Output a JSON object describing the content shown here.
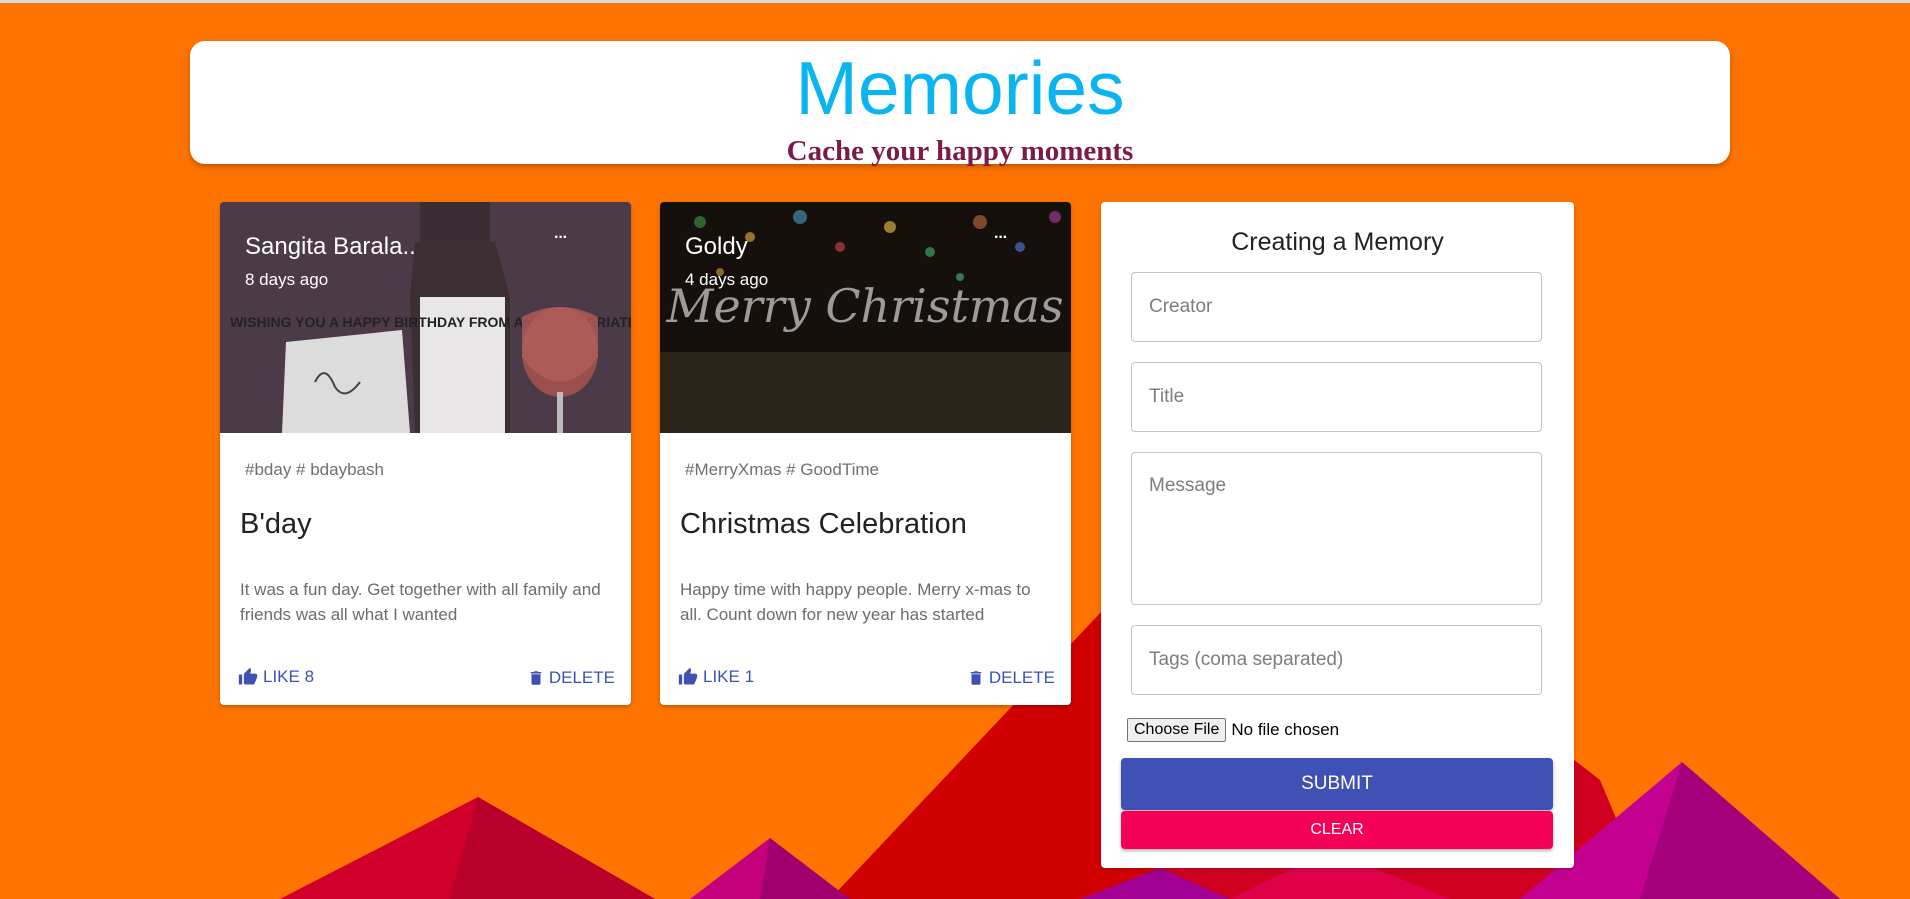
{
  "header": {
    "title": "Memories",
    "subtitle": "Cache your happy moments"
  },
  "posts": [
    {
      "creator": "Sangita Barala..",
      "time": "8 days ago",
      "more": "···",
      "tags": "#bday # bdaybash",
      "title": "B'day",
      "message": "It was a fun day. Get together with all family and friends was all what I wanted",
      "like_label": "LIKE 8",
      "delete_label": "DELETE",
      "image_text": "WISHING YOU A HAPPY BIRTHDAY FROM AN APPROPRIATE SOCIAL"
    },
    {
      "creator": "Goldy",
      "time": "4 days ago",
      "more": "···",
      "tags": "#MerryXmas # GoodTime",
      "title": "Christmas Celebration",
      "message": "Happy time with happy people. Merry x-mas to all. Count down for new year has started",
      "like_label": "LIKE 1",
      "delete_label": "DELETE",
      "image_text": "Merry Christmas"
    }
  ],
  "form": {
    "title": "Creating a Memory",
    "creator_placeholder": "Creator",
    "title_placeholder": "Title",
    "message_placeholder": "Message",
    "tags_placeholder": "Tags (coma separated)",
    "file_button": "Choose File",
    "file_status": "No file chosen",
    "submit_label": "SUBMIT",
    "clear_label": "CLEAR"
  },
  "colors": {
    "background": "#ff7400",
    "title": "#09b4f0",
    "subtitle": "#7a1b4a",
    "primary": "#3f51b5",
    "secondary": "#f50057"
  }
}
